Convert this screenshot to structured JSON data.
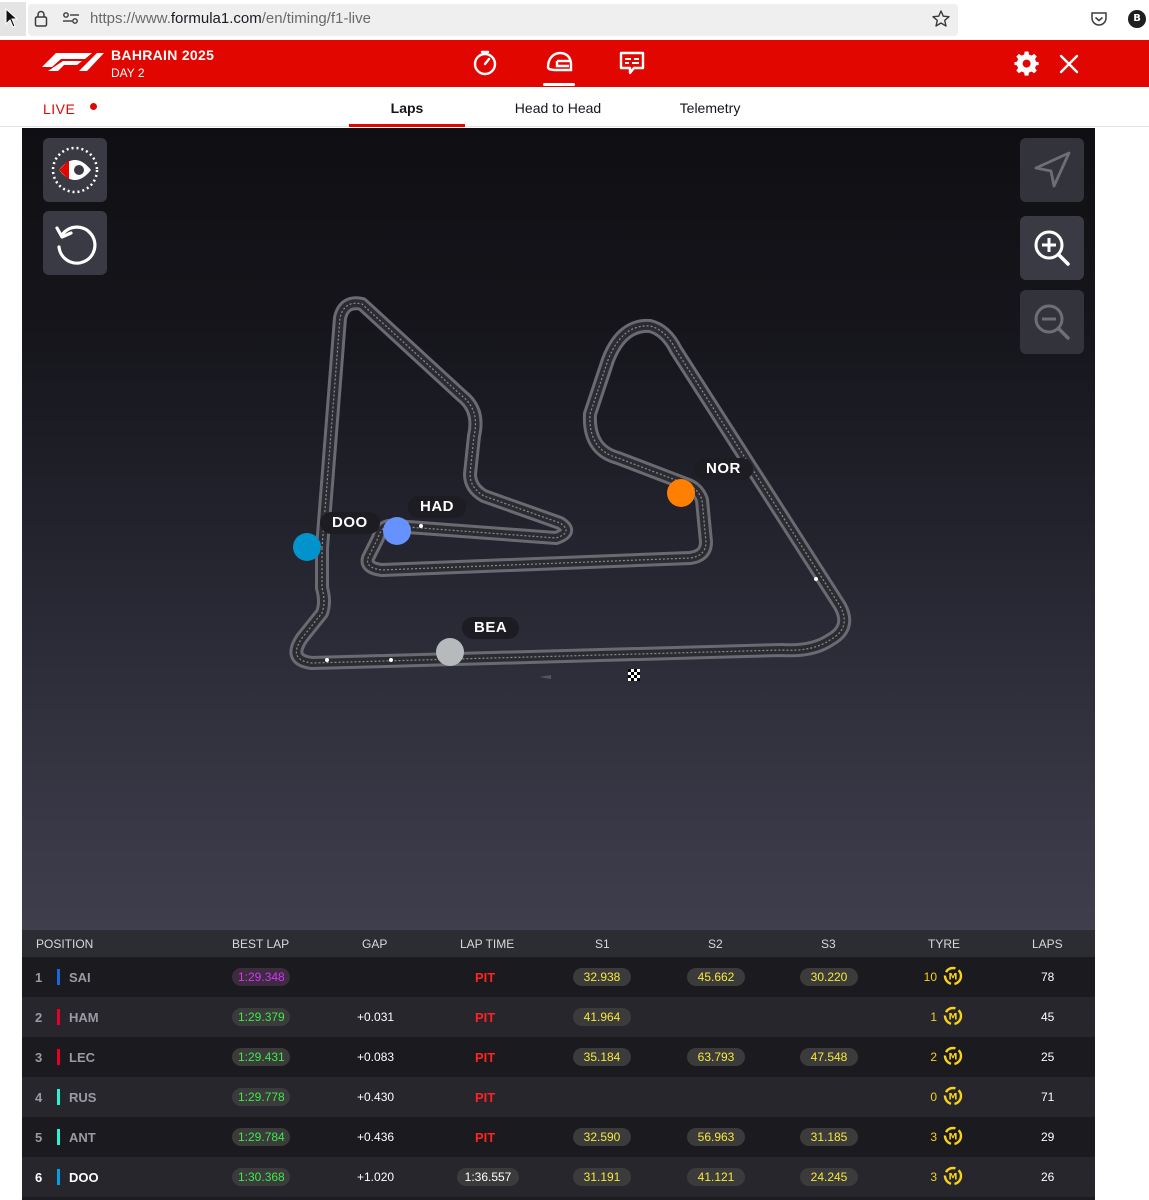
{
  "browser": {
    "url_prefix": "https://www.",
    "url_domain": "formula1.com",
    "url_path": "/en/timing/f1-live",
    "avatar_letter": "B"
  },
  "header": {
    "event_title": "BAHRAIN 2025",
    "event_day": "DAY 2",
    "icons": [
      "timer-icon",
      "helmet-icon",
      "chat-icon"
    ],
    "brand_color": "#e10600"
  },
  "tabs": {
    "live_label": "LIVE",
    "items": [
      "Laps",
      "Head to Head",
      "Telemetry"
    ],
    "active": "Laps"
  },
  "map": {
    "drivers": [
      {
        "code": "DOO",
        "color": "#0093cc"
      },
      {
        "code": "HAD",
        "color": "#6692ff"
      },
      {
        "code": "NOR",
        "color": "#ff8000"
      },
      {
        "code": "BEA",
        "color": "#b6babd"
      }
    ]
  },
  "table": {
    "headers": [
      "POSITION",
      "BEST LAP",
      "GAP",
      "LAP TIME",
      "S1",
      "S2",
      "S3",
      "TYRE",
      "LAPS"
    ],
    "rows": [
      {
        "pos": "1",
        "code": "SAI",
        "team_color": "#1868db",
        "best": "1:29.348",
        "best_purple": true,
        "gap": "",
        "lap": "PIT",
        "s1": "32.938",
        "s2": "45.662",
        "s3": "30.220",
        "tyre_laps": "10",
        "tyre": "M",
        "laps": "78"
      },
      {
        "pos": "2",
        "code": "HAM",
        "team_color": "#e8002d",
        "best": "1:29.379",
        "best_purple": false,
        "gap": "+0.031",
        "lap": "PIT",
        "s1": "41.964",
        "s2": "",
        "s3": "",
        "tyre_laps": "1",
        "tyre": "M",
        "laps": "45"
      },
      {
        "pos": "3",
        "code": "LEC",
        "team_color": "#e8002d",
        "best": "1:29.431",
        "best_purple": false,
        "gap": "+0.083",
        "lap": "PIT",
        "s1": "35.184",
        "s2": "63.793",
        "s3": "47.548",
        "tyre_laps": "2",
        "tyre": "M",
        "laps": "25"
      },
      {
        "pos": "4",
        "code": "RUS",
        "team_color": "#27f4d2",
        "best": "1:29.778",
        "best_purple": false,
        "gap": "+0.430",
        "lap": "PIT",
        "s1": "",
        "s2": "",
        "s3": "",
        "tyre_laps": "0",
        "tyre": "M",
        "laps": "71"
      },
      {
        "pos": "5",
        "code": "ANT",
        "team_color": "#27f4d2",
        "best": "1:29.784",
        "best_purple": false,
        "gap": "+0.436",
        "lap": "PIT",
        "s1": "32.590",
        "s2": "56.963",
        "s3": "31.185",
        "tyre_laps": "3",
        "tyre": "M",
        "laps": "29"
      },
      {
        "pos": "6",
        "code": "DOO",
        "team_color": "#00a1e8",
        "best": "1:30.368",
        "best_purple": false,
        "gap": "+1.020",
        "lap": "1:36.557",
        "s1": "31.191",
        "s2": "41.121",
        "s3": "24.245",
        "tyre_laps": "3",
        "tyre": "M",
        "laps": "26"
      }
    ]
  }
}
